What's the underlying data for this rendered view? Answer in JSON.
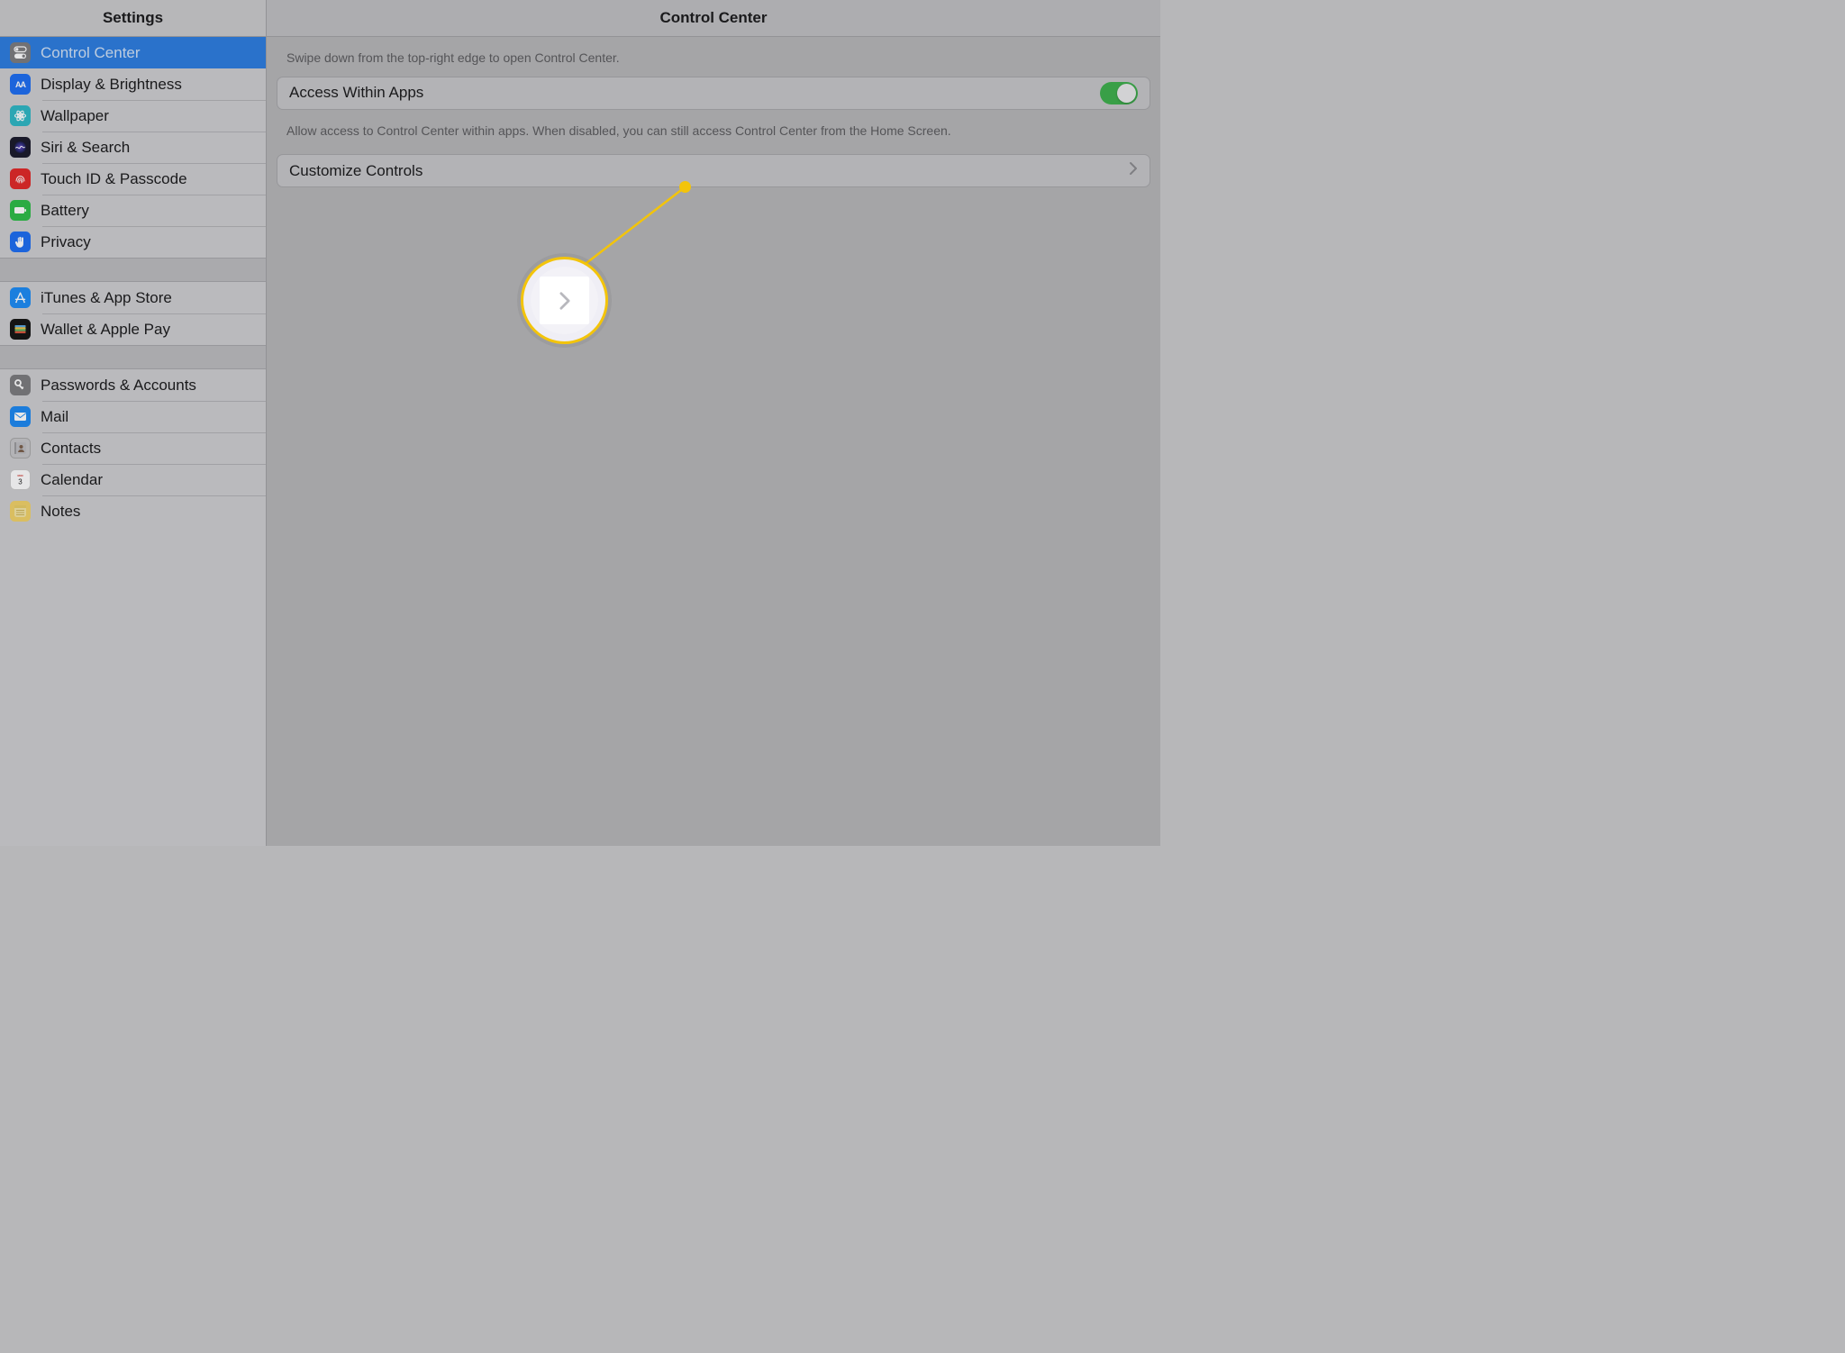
{
  "sidebar": {
    "title": "Settings",
    "sections": [
      [
        {
          "id": "control-center",
          "label": "Control Center",
          "icon": "toggles",
          "bg": "#7d7d80",
          "selected": true
        },
        {
          "id": "display",
          "label": "Display & Brightness",
          "icon": "AA",
          "bg": "#1f6ff2"
        },
        {
          "id": "wallpaper",
          "label": "Wallpaper",
          "icon": "flower",
          "bg": "#2fb8c6"
        },
        {
          "id": "siri",
          "label": "Siri & Search",
          "icon": "siri",
          "bg": "#1b1b2d"
        },
        {
          "id": "touchid",
          "label": "Touch ID & Passcode",
          "icon": "fingerprint",
          "bg": "#e22a2a"
        },
        {
          "id": "battery",
          "label": "Battery",
          "icon": "battery",
          "bg": "#2fbe4a"
        },
        {
          "id": "privacy",
          "label": "Privacy",
          "icon": "hand",
          "bg": "#1f6ff2"
        }
      ],
      [
        {
          "id": "itunes",
          "label": "iTunes & App Store",
          "icon": "appstore",
          "bg": "#1e8df5"
        },
        {
          "id": "wallet",
          "label": "Wallet & Apple Pay",
          "icon": "wallet",
          "bg": "#161616"
        }
      ],
      [
        {
          "id": "passwords",
          "label": "Passwords & Accounts",
          "icon": "key",
          "bg": "#7d7d80"
        },
        {
          "id": "mail",
          "label": "Mail",
          "icon": "mail",
          "bg": "#1d8af2"
        },
        {
          "id": "contacts",
          "label": "Contacts",
          "icon": "contacts",
          "bg": "#c7c7c9"
        },
        {
          "id": "calendar",
          "label": "Calendar",
          "icon": "calendar",
          "bg": "#ffffff"
        },
        {
          "id": "notes",
          "label": "Notes",
          "icon": "notes",
          "bg": "#f2d36a"
        }
      ]
    ]
  },
  "main": {
    "title": "Control Center",
    "top_hint": "Swipe down from the top-right edge to open Control Center.",
    "access_row": {
      "title": "Access Within Apps",
      "on": true
    },
    "access_hint": "Allow access to Control Center within apps. When disabled, you can still access Control Center from the Home Screen.",
    "customize_row": {
      "title": "Customize Controls"
    }
  }
}
